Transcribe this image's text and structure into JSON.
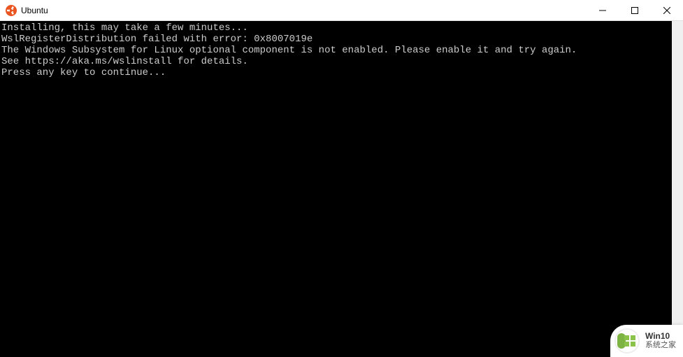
{
  "titlebar": {
    "title": "Ubuntu"
  },
  "terminal": {
    "line1": "Installing, this may take a few minutes...",
    "line2": "WslRegisterDistribution failed with error: 0x8007019e",
    "line3": "The Windows Subsystem for Linux optional component is not enabled. Please enable it and try again.",
    "line4": "See https://aka.ms/wslinstall for details.",
    "line5": "Press any key to continue..."
  },
  "watermark": {
    "line1": "Win10",
    "line2": "系统之家"
  }
}
